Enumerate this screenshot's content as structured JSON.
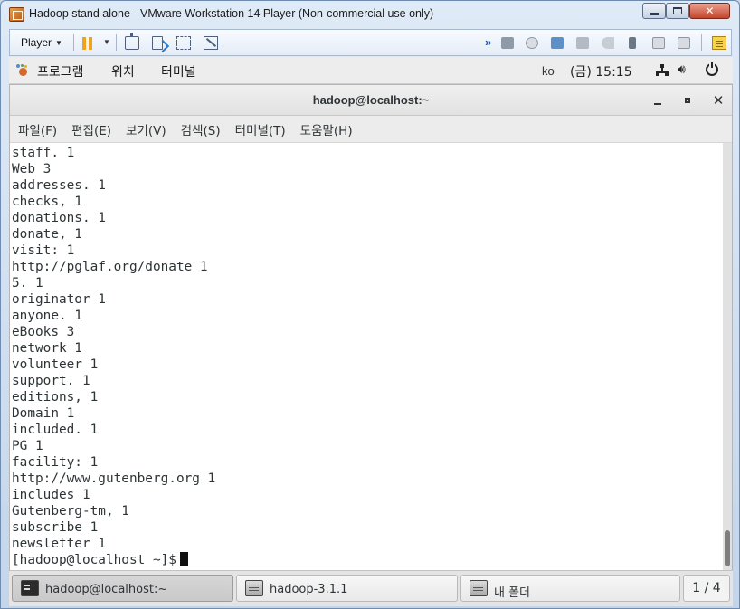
{
  "vmware": {
    "title": "Hadoop stand alone - VMware Workstation 14 Player (Non-commercial use only)",
    "player_label": "Player"
  },
  "gnome_panel": {
    "applications": "프로그램",
    "places": "위치",
    "terminal": "터미널",
    "ime": "ko",
    "clock": "(금) 15:15"
  },
  "terminal": {
    "title": "hadoop@localhost:~",
    "menu": [
      "파일(F)",
      "편집(E)",
      "보기(V)",
      "검색(S)",
      "터미널(T)",
      "도움말(H)"
    ],
    "lines": [
      "staff. 1",
      "Web 3",
      "addresses. 1",
      "checks, 1",
      "donations. 1",
      "donate, 1",
      "visit: 1",
      "http://pglaf.org/donate 1",
      "5. 1",
      "originator 1",
      "anyone. 1",
      "eBooks 3",
      "network 1",
      "volunteer 1",
      "support. 1",
      "editions, 1",
      "Domain 1",
      "included. 1",
      "PG 1",
      "facility: 1",
      "http://www.gutenberg.org 1",
      "includes 1",
      "Gutenberg-tm, 1",
      "subscribe 1",
      "newsletter 1"
    ],
    "prompt": "[hadoop@localhost ~]$"
  },
  "taskbar": {
    "items": [
      {
        "label": "hadoop@localhost:~",
        "icon": "terminal-icon",
        "active": true
      },
      {
        "label": "hadoop-3.1.1",
        "icon": "folder-icon",
        "active": false
      },
      {
        "label": "내 폴더",
        "icon": "folder-icon",
        "active": false
      }
    ],
    "workspace": "1 / 4"
  }
}
